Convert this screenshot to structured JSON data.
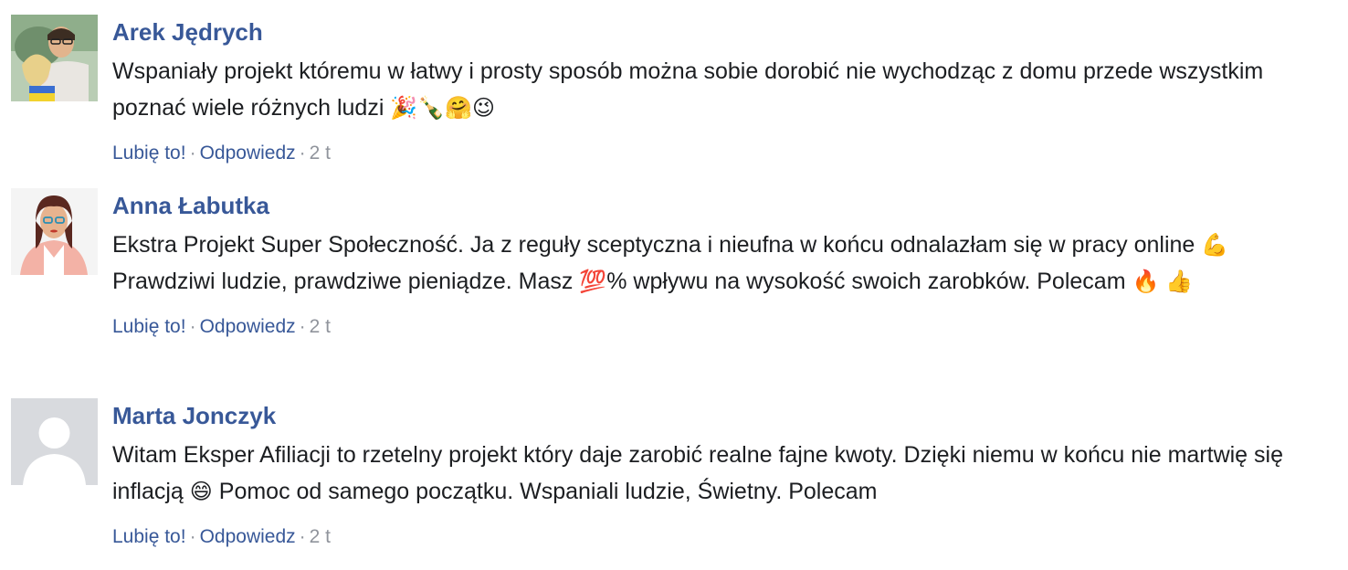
{
  "comments": [
    {
      "author": "Arek Jędrych",
      "text": "Wspaniały projekt któremu w łatwy i prosty sposób można sobie dorobić nie wychodząc z domu przede wszystkim poznać wiele różnych ludzi",
      "emojis": "🎉🍾🤗😉",
      "like_label": "Lubię to!",
      "reply_label": "Odpowiedz",
      "separator": "·",
      "time": "2 t",
      "avatar": "user-photo"
    },
    {
      "author": "Anna Łabutka",
      "text_part1": "Ekstra Projekt Super Społeczność. Ja z reguły sceptyczna i nieufna w końcu odnalazłam się w pracy online",
      "emoji1": "💪",
      "text_part2": "Prawdziwi ludzie, prawdziwe pieniądze. Masz",
      "emoji2": "💯",
      "text_part3": "% wpływu na wysokość swoich zarobków. Polecam",
      "emoji3": "🔥",
      "emoji4": "👍",
      "like_label": "Lubię to!",
      "reply_label": "Odpowiedz",
      "separator": "·",
      "time": "2 t",
      "avatar": "user-photo"
    },
    {
      "author": "Marta Jonczyk",
      "text_part1": "Witam Eksper Afiliacji to rzetelny projekt który daje zarobić realne fajne kwoty. Dzięki niemu w końcu nie martwię się inflacją",
      "emoji1": "😄",
      "text_part2": "Pomoc od samego początku. Wspaniali ludzie, Świetny. Polecam",
      "like_label": "Lubię to!",
      "reply_label": "Odpowiedz",
      "separator": "·",
      "time": "2 t",
      "avatar": "default-avatar"
    }
  ],
  "colors": {
    "link": "#385898",
    "text": "#1c1e21",
    "meta": "#90949c",
    "default_avatar_bg": "#d8dade"
  }
}
